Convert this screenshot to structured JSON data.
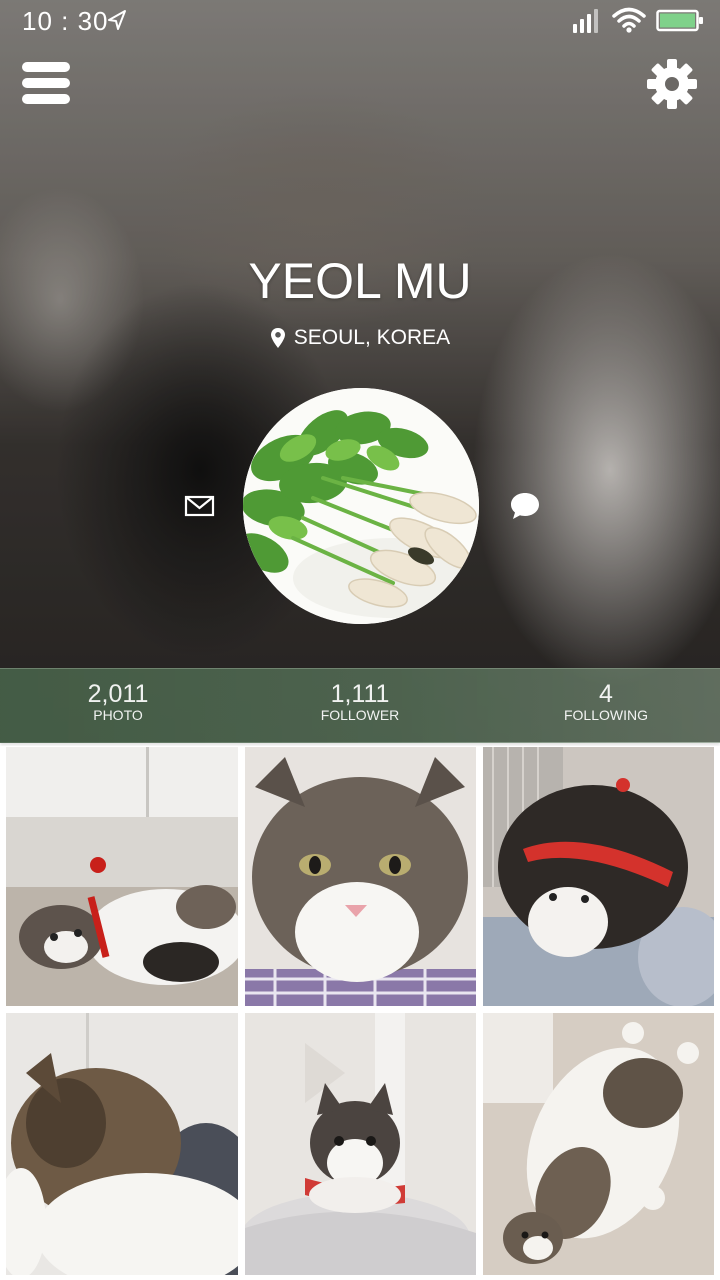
{
  "status_bar": {
    "time": "10 : 30",
    "nav_icon": "navigation-arrow-icon",
    "signal_icon": "cell-signal-icon",
    "wifi_icon": "wifi-icon",
    "battery_icon": "battery-icon",
    "battery_color": "#7fd18a"
  },
  "header": {
    "menu_icon": "hamburger-menu-icon",
    "settings_icon": "gear-icon"
  },
  "profile": {
    "name": "YEOL MU",
    "location": "SEOUL, KOREA",
    "location_icon": "map-pin-icon",
    "avatar": "radish-bunch-photo",
    "message_icon": "envelope-icon",
    "chat_icon": "chat-bubble-icon"
  },
  "stats": [
    {
      "value": "2,011",
      "label": "PHOTO"
    },
    {
      "value": "1,111",
      "label": "FOLLOWER"
    },
    {
      "value": "4",
      "label": "FOLLOWING"
    }
  ],
  "colors": {
    "stats_bar": "#4f6b52",
    "text_on_dark": "#ffffff"
  },
  "photos": [
    {
      "subject": "cat-lying-on-floor-red-collar"
    },
    {
      "subject": "cat-face-closeup"
    },
    {
      "subject": "cat-with-red-frill-on-bed"
    },
    {
      "subject": "cat-back-of-head"
    },
    {
      "subject": "cat-in-red-harness-on-pillow"
    },
    {
      "subject": "cat-lying-on-back"
    }
  ]
}
